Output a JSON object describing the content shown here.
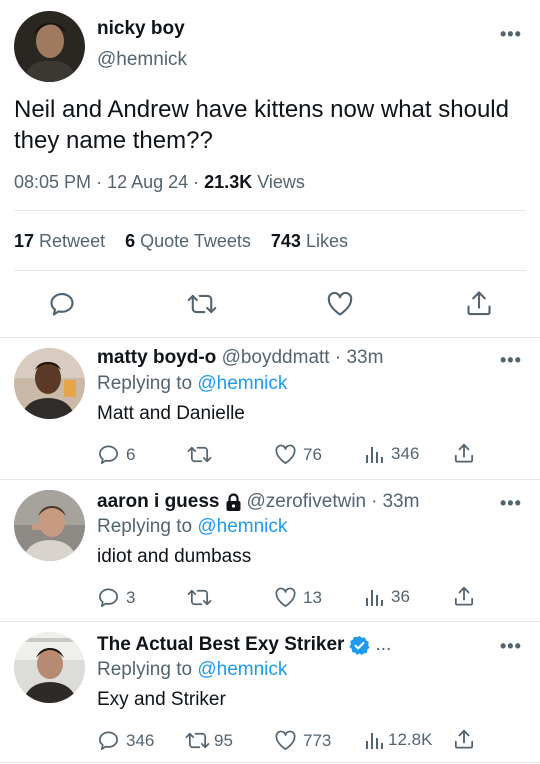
{
  "main_tweet": {
    "name": "nicky boy",
    "handle": "@hemnick",
    "text": "Neil and Andrew have kittens now what should they name them??",
    "time": "08:05 PM",
    "date": "12 Aug 24",
    "views_count": "21.3K",
    "views_label": "Views",
    "retweets_count": "17",
    "retweets_label": "Retweet",
    "quotes_count": "6",
    "quotes_label": "Quote Tweets",
    "likes_count": "743",
    "likes_label": "Likes"
  },
  "replies": [
    {
      "name": "matty boyd-o",
      "handle": "@boyddmatt",
      "time": "33m",
      "replying_label": "Replying to",
      "replying_to": "@hemnick",
      "text": "Matt and Danielle",
      "replies": "6",
      "retweets": "",
      "likes": "76",
      "views": "346"
    },
    {
      "name": "aaron i guess",
      "handle": "@zerofivetwin",
      "time": "33m",
      "replying_label": "Replying to",
      "replying_to": "@hemnick",
      "text": "idiot and dumbass",
      "replies": "3",
      "retweets": "",
      "likes": "13",
      "views": "36"
    },
    {
      "name": "The Actual Best Exy Striker",
      "handle": "...",
      "time": "",
      "replying_label": "Replying to",
      "replying_to": "@hemnick",
      "text": "Exy and Striker",
      "replies": "346",
      "retweets": "95",
      "likes": "773",
      "views": "12.8K"
    }
  ],
  "colors": {
    "accent": "#1d9bf0",
    "muted": "#536471",
    "text": "#0f1419",
    "divider": "#e6e8ea"
  }
}
